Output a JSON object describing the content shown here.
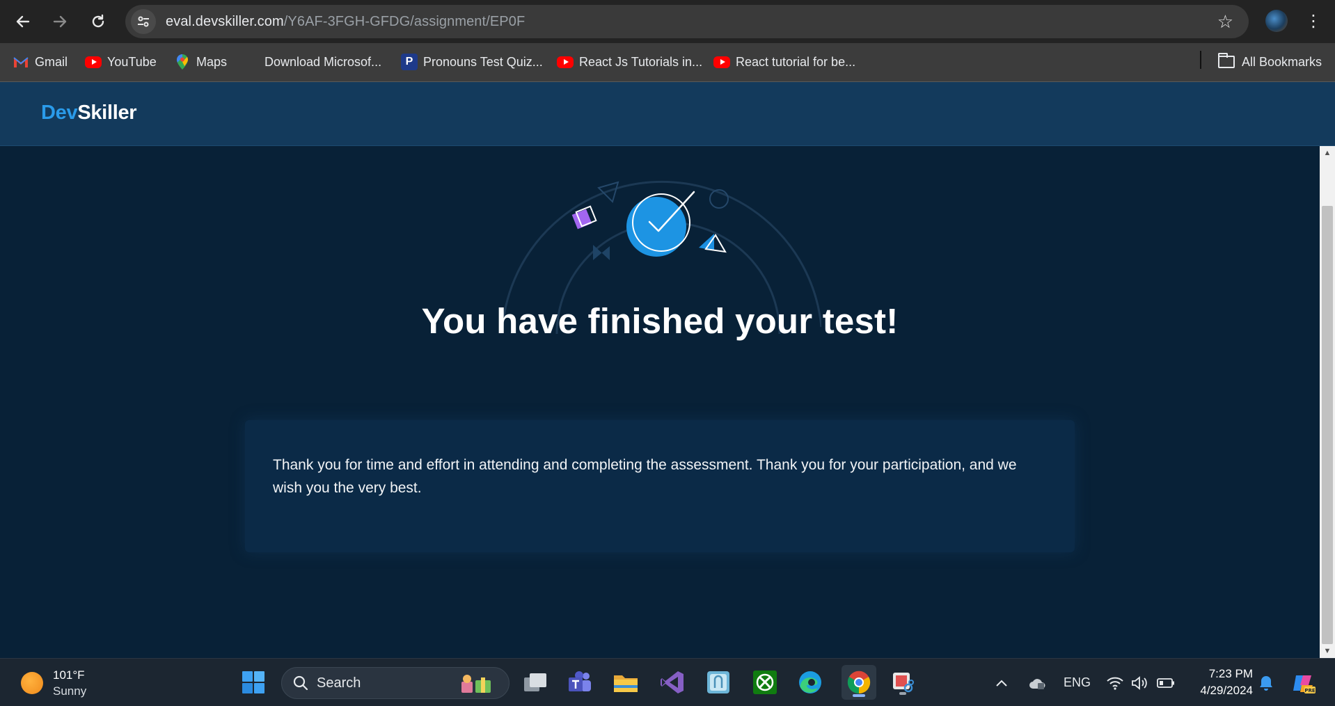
{
  "browser": {
    "url_host": "eval.devskiller.com",
    "url_path": "/Y6AF-3FGH-GFDG/assignment/EP0F",
    "bookmarks": [
      {
        "label": "Gmail",
        "icon": "gmail-icon"
      },
      {
        "label": "YouTube",
        "icon": "youtube-icon"
      },
      {
        "label": "Maps",
        "icon": "maps-icon"
      },
      {
        "label": "Download Microsof...",
        "icon": "microsoft-icon"
      },
      {
        "label": "Pronouns Test Quiz...",
        "icon": "pronouns-icon"
      },
      {
        "label": "React Js Tutorials in...",
        "icon": "youtube-icon"
      },
      {
        "label": "React tutorial for be...",
        "icon": "youtube-icon"
      }
    ],
    "all_bookmarks_label": "All Bookmarks"
  },
  "site": {
    "logo_dev": "Dev",
    "logo_skiller": "Skiller",
    "headline": "You have finished your test!",
    "message": "Thank you for time and effort in attending and completing the assessment. Thank you for your participation, and we wish you the very best."
  },
  "taskbar": {
    "weather_temp": "101°F",
    "weather_condition": "Sunny",
    "search_placeholder": "Search",
    "language": "ENG",
    "time": "7:23 PM",
    "date": "4/29/2024"
  },
  "colors": {
    "brand_blue": "#2a9bea",
    "page_background": "#082137",
    "header_background": "#133a5c",
    "card_background": "#0b2a47"
  }
}
